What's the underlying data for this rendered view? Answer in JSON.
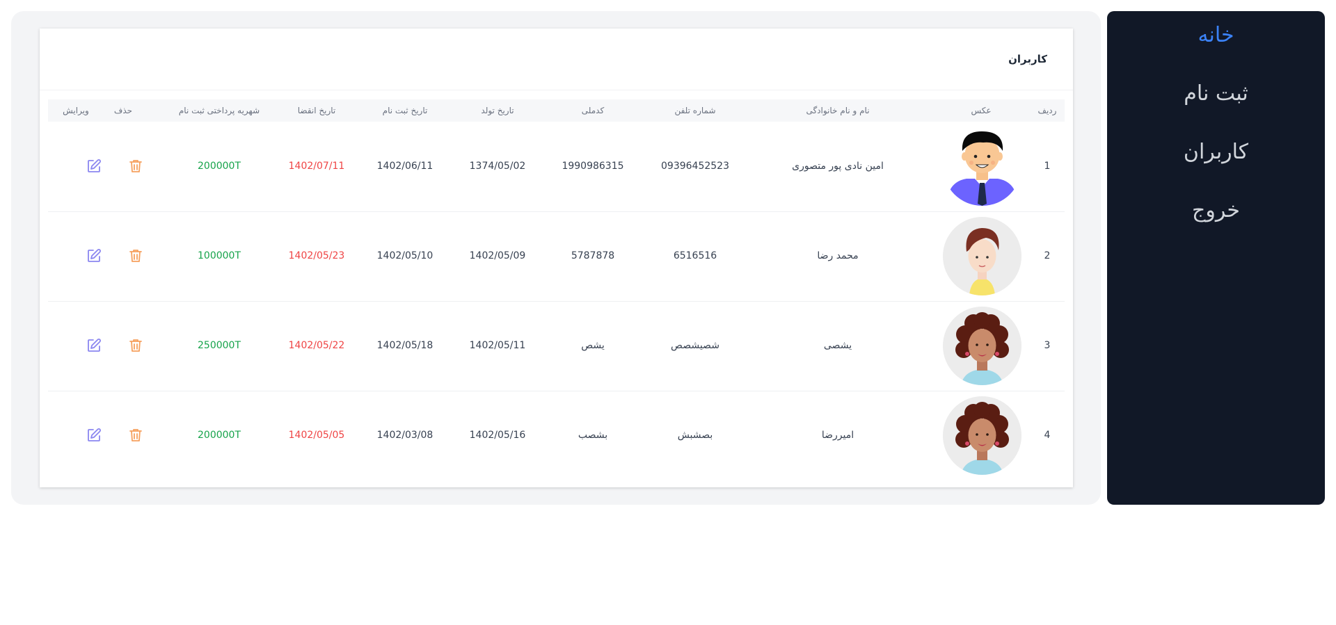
{
  "sidebar": {
    "items": [
      {
        "label": "خانه",
        "active": true
      },
      {
        "label": "ثبت نام",
        "active": false
      },
      {
        "label": "کاربران",
        "active": false
      },
      {
        "label": "خروج",
        "active": false
      }
    ]
  },
  "card": {
    "title": "کاربران"
  },
  "table": {
    "headers": {
      "index": "ردیف",
      "photo": "عکس",
      "name": "نام و نام خانوادگی",
      "phone": "شماره تلفن",
      "national_code": "کدملی",
      "birth_date": "تاریخ تولد",
      "register_date": "تاریخ ثبت نام",
      "expire_date": "تاریخ انقضا",
      "fee": "شهریه پرداختی ثبت نام",
      "delete": "حذف",
      "edit": "ویرایش"
    },
    "rows": [
      {
        "index": "1",
        "avatar": "man-with-tie-avatar",
        "name": "امین نادی پور متصوری",
        "phone": "09396452523",
        "national_code": "1990986315",
        "birth_date": "1374/05/02",
        "register_date": "1402/06/11",
        "expire_date": "1402/07/11",
        "fee": "200000T"
      },
      {
        "index": "2",
        "avatar": "boy-avatar",
        "name": "محمد رضا",
        "phone": "6516516",
        "national_code": "5787878",
        "birth_date": "1402/05/09",
        "register_date": "1402/05/10",
        "expire_date": "1402/05/23",
        "fee": "100000T"
      },
      {
        "index": "3",
        "avatar": "curly-hair-woman-avatar",
        "name": "یشصی",
        "phone": "شصیشصص",
        "national_code": "یشص",
        "birth_date": "1402/05/11",
        "register_date": "1402/05/18",
        "expire_date": "1402/05/22",
        "fee": "250000T"
      },
      {
        "index": "4",
        "avatar": "curly-hair-woman-avatar",
        "name": "امیررضا",
        "phone": "بصشبش",
        "national_code": "بشصب",
        "birth_date": "1402/05/16",
        "register_date": "1402/03/08",
        "expire_date": "1402/05/05",
        "fee": "200000T"
      }
    ]
  },
  "icons": {
    "delete": "trash-icon",
    "edit": "edit-icon"
  },
  "colors": {
    "sidebar_bg": "#111827",
    "active_nav": "#3b82f6",
    "expire_date": "#ef4444",
    "fee": "#16a34a",
    "trash_icon": "#f6a15f",
    "edit_icon": "#8b86f0"
  }
}
